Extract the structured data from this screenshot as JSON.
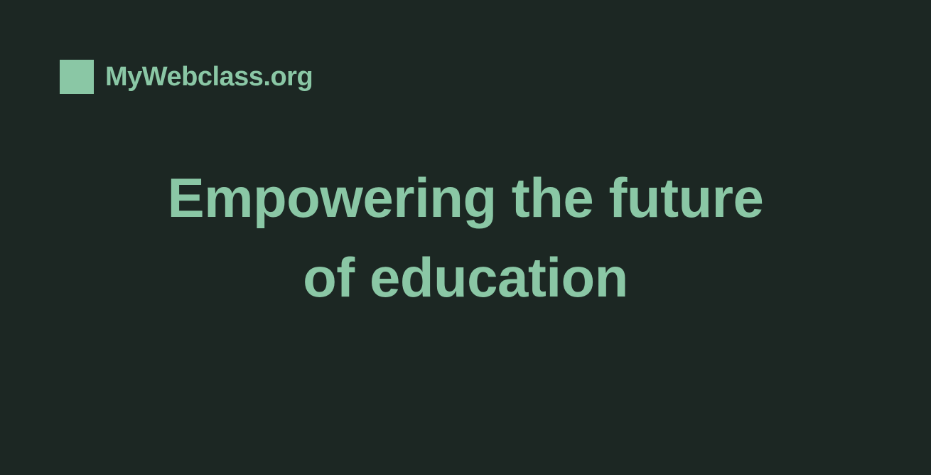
{
  "brand": {
    "name": "MyWebclass.org"
  },
  "hero": {
    "line1": "Empowering the future",
    "line2": "of education"
  },
  "colors": {
    "background": "#1c2723",
    "accent": "#8ac7a5"
  }
}
